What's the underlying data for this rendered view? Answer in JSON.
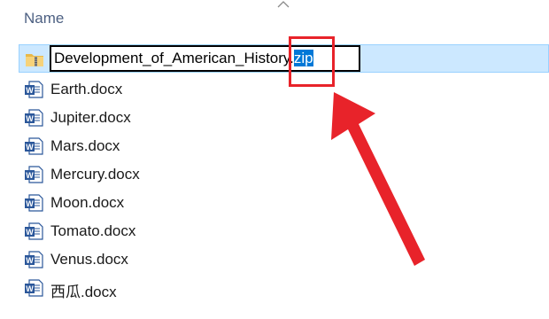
{
  "header": {
    "name_column_label": "Name"
  },
  "files": {
    "renaming": {
      "base_name": "Development_of_American_History.",
      "selected_extension": "zip",
      "icon": "zip-folder-icon"
    },
    "items": [
      {
        "name": "Earth.docx",
        "icon": "word-doc-icon"
      },
      {
        "name": "Jupiter.docx",
        "icon": "word-doc-icon"
      },
      {
        "name": "Mars.docx",
        "icon": "word-doc-icon"
      },
      {
        "name": "Mercury.docx",
        "icon": "word-doc-icon"
      },
      {
        "name": "Moon.docx",
        "icon": "word-doc-icon"
      },
      {
        "name": "Tomato.docx",
        "icon": "word-doc-icon"
      },
      {
        "name": "Venus.docx",
        "icon": "word-doc-icon"
      },
      {
        "name": "西瓜.docx",
        "icon": "word-doc-icon"
      }
    ]
  },
  "colors": {
    "selection_bg": "#cce8ff",
    "text_highlight": "#0078d7",
    "annotation_red": "#e8232a",
    "word_blue": "#2b579a"
  }
}
